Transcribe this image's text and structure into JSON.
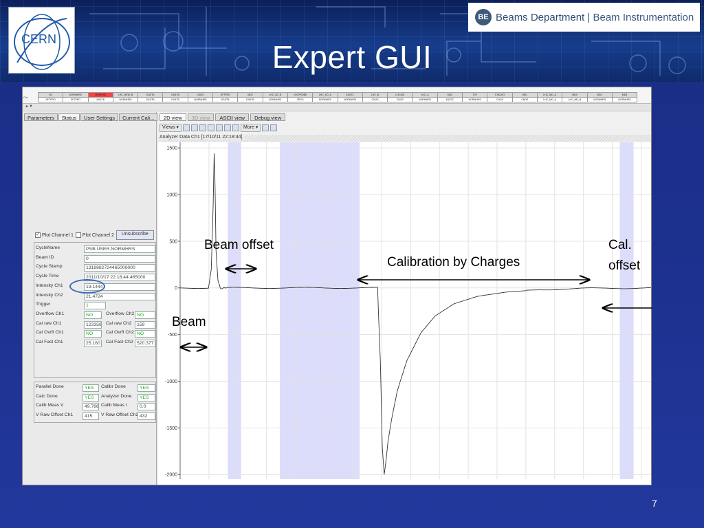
{
  "slide": {
    "title": "Expert GUI",
    "page_number": "7",
    "logos": {
      "cern": "CERN",
      "be_badge": "BE",
      "be_dept": "Beams Department",
      "be_sep": "|",
      "be_group": "Beam Instrumentation"
    }
  },
  "status_table": {
    "row_label": "Cnt",
    "row1": [
      "XD",
      "NORMHRS",
      "MDNRMS",
      "LHC_NEW_B",
      "EASTA",
      "EASTB",
      "CNGS",
      "SFTPRO",
      "MD2",
      "LHC_SD_B",
      "LHCPROBE",
      "LHC_SD_A",
      "EASTC",
      "LHC_B",
      "LHC400",
      "LHC_A",
      "MD3",
      "TOF",
      "STACKO",
      "MD1",
      "LHC_MD_A",
      "MD4",
      "MD1",
      "MD5"
    ],
    "row2": [
      "SFTPRO",
      "SFTPRO",
      "EASTB",
      "NORMHRS",
      "EASTB",
      "EASTB",
      "NORMHRS",
      "EASTB",
      "EASTB",
      "NORMHRS",
      "ZERO",
      "NORMHRS",
      "NORMHRS",
      "CNGS",
      "CNGS",
      "NORMHRS",
      "EASTC",
      "NORMHRS",
      "CNGS",
      "CNGS",
      "LHC_MD_A",
      "LHC_MD_B",
      "NORMHRS",
      "NORMHRS"
    ],
    "highlight": {
      "red": 2,
      "yellow": 2,
      "green": 3
    }
  },
  "left_panel": {
    "tabs": [
      "Parameters",
      "Status",
      "User Settings",
      "Current Cali..."
    ],
    "active_tab": "Status",
    "plot_ch1": "Plot Channel 1",
    "plot_ch2": "Plot Channel 2",
    "unsubscribe": "Unsubscribe",
    "fields": [
      {
        "label": "CycleName",
        "value": "PSB.USER.NORMHRS"
      },
      {
        "label": "Beam ID",
        "value": "0"
      },
      {
        "label": "Cycle Stamp",
        "value": "1318882724465000000"
      },
      {
        "label": "Cycle Time",
        "value": "2011/10/17 22:18:44.465000"
      },
      {
        "label": "Intensity Ch1",
        "value": "19.1444"
      },
      {
        "label": "Intensity Ch2",
        "value": "21.4724"
      },
      {
        "label": "Trigger",
        "value": "1"
      }
    ],
    "pair_fields": [
      {
        "l1": "Overflow Ch1",
        "v1": "NO",
        "l2": "Overflow Ch2",
        "v2": "NO",
        "green": true
      },
      {
        "l1": "Cal raw Ch1",
        "v1": "123359",
        "l2": "Cal raw Ch2",
        "v2": "159",
        "green": false
      },
      {
        "l1": "Cal Ovrfl Ch1",
        "v1": "NO",
        "l2": "Cal Ovrfl Ch2",
        "v2": "NO",
        "green": true
      },
      {
        "l1": "Cal Fact Ch1",
        "v1": "25.160",
        "l2": "Cal Fact Ch2",
        "v2": "520.377",
        "green": false
      }
    ],
    "status_fields": [
      {
        "l1": "Parallel Done",
        "v1": "YES",
        "l2": "Calibr Done",
        "v2": "YES",
        "green": true
      },
      {
        "l1": "Calc Done",
        "v1": "YES",
        "l2": "Analyzer Done",
        "v2": "YES",
        "green": true
      },
      {
        "l1": "Calib Meas V",
        "v1": "49.786",
        "l2": "Calib Meas I",
        "v2": "0.0",
        "green": false
      },
      {
        "l1": "V Raw Offset Ch1",
        "v1": "415",
        "l2": "V Raw Offset Ch2",
        "v2": "432",
        "green": false
      }
    ]
  },
  "chart_area": {
    "view_tabs": [
      "2D view",
      "3D view",
      "ASCII view",
      "Debug view"
    ],
    "active_view": "2D view",
    "toolbar": {
      "views": "Views",
      "more": "More"
    },
    "header": "Analyzer Data Ch1  [17/10/11 22:18:44]"
  },
  "chart_data": {
    "type": "line",
    "title": "",
    "xlabel": "",
    "ylabel": "",
    "ylim": [
      -2050,
      1560
    ],
    "xlim": [
      0,
      1000
    ],
    "yticks": [
      1500,
      1000,
      500,
      0,
      -500,
      -1000,
      -1500,
      -2000
    ],
    "ytick_labels": [
      "1500",
      "1000",
      "500",
      "0",
      "-500",
      "-1000",
      "-1500",
      "-2000"
    ],
    "grid": true,
    "shaded_regions": [
      [
        101,
        129
      ],
      [
        211,
        380
      ],
      [
        931,
        960
      ]
    ],
    "series": [
      {
        "x": [
          0,
          60,
          66,
          70,
          72,
          74,
          76,
          80,
          85,
          90,
          95,
          100,
          200,
          300,
          400,
          418,
          424,
          428,
          432,
          436,
          440,
          448,
          460,
          480,
          510,
          540,
          580,
          630,
          690,
          760,
          850,
          1000
        ],
        "y": [
          0,
          0,
          200,
          900,
          1440,
          1100,
          400,
          80,
          0,
          -10,
          5,
          0,
          0,
          0,
          0,
          0,
          -800,
          -1700,
          -2000,
          -1850,
          -1650,
          -1400,
          -1100,
          -780,
          -480,
          -300,
          -170,
          -90,
          -45,
          -20,
          -6,
          0
        ]
      }
    ]
  },
  "annotations": {
    "beam_offset": "Beam offset",
    "calibration": "Calibration by Charges",
    "cal_offset_1": "Cal.",
    "cal_offset_2": "offset",
    "beam": "Beam"
  }
}
